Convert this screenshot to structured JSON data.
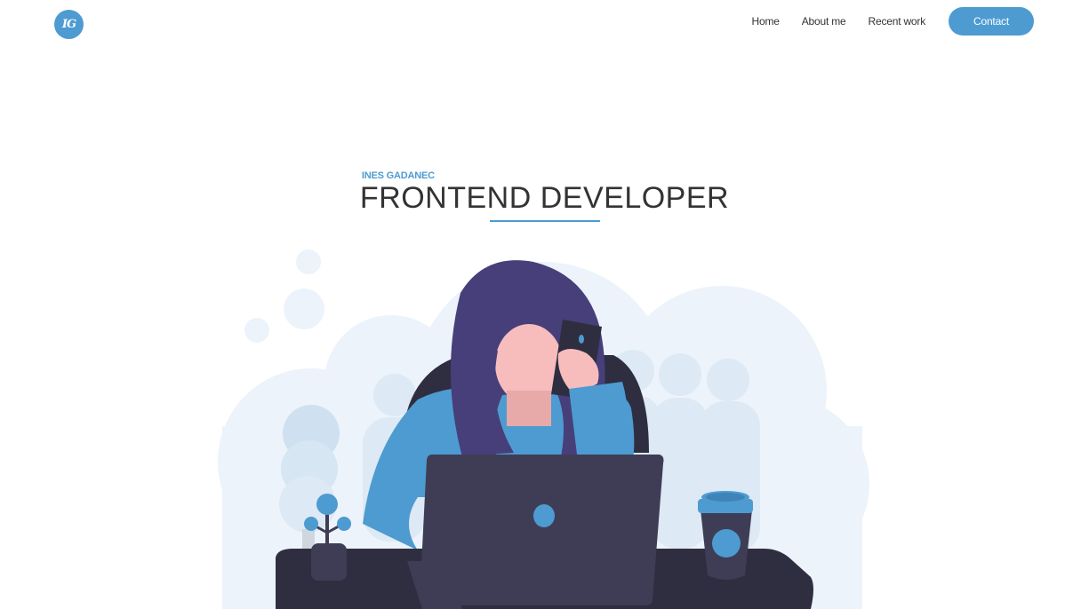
{
  "header": {
    "logo_text": "IG",
    "nav": {
      "home": "Home",
      "about": "About me",
      "recent": "Recent work",
      "contact": "Contact"
    }
  },
  "hero": {
    "name": "INES GADANEC",
    "role": "FRONTEND DEVELOPER"
  },
  "colors": {
    "accent": "#4d9bd1",
    "text": "#333333",
    "hair": "#473f7a",
    "dark": "#2f2e41",
    "skin": "#f7bdbd",
    "cloud": "#ecf3fa"
  },
  "illustration": {
    "icon": "woman-on-phone-at-laptop-illustration"
  }
}
